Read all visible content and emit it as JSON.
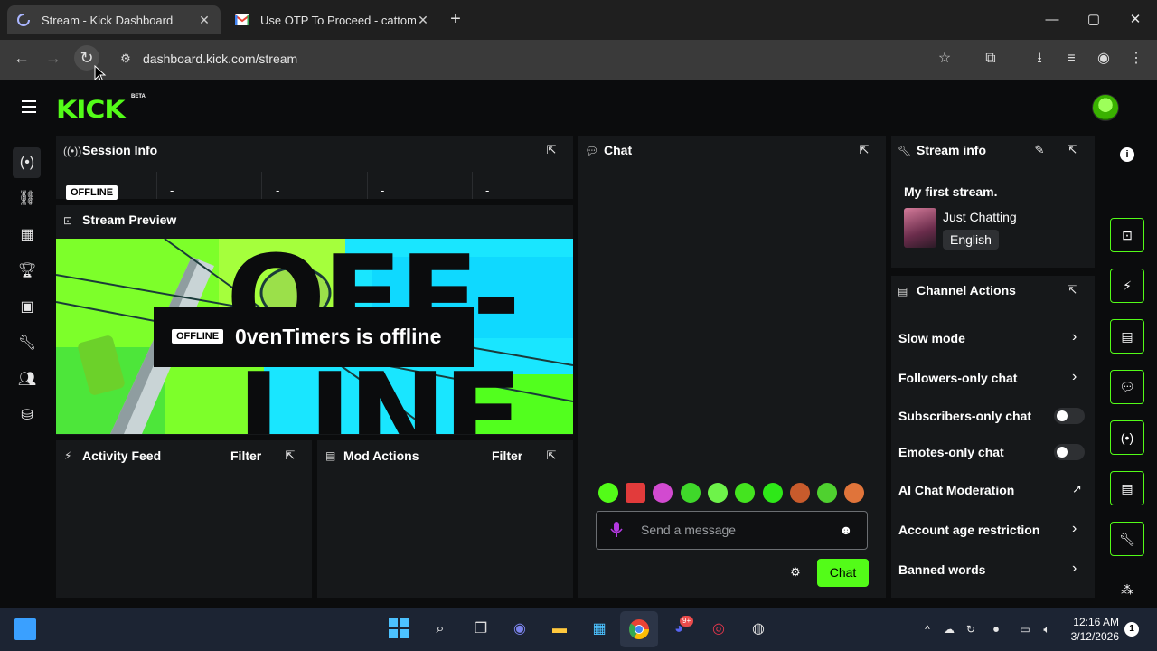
{
  "browser": {
    "tabs": [
      {
        "title": "Stream - Kick Dashboard",
        "icon": "loading-spinner-icon",
        "active": true
      },
      {
        "title": "Use OTP To Proceed - cattomti",
        "icon": "gmail-icon",
        "active": false
      }
    ],
    "new_tab_glyph": "+",
    "url": "dashboard.kick.com/stream",
    "window_controls": {
      "minimize": "—",
      "maximize": "▢",
      "close": "✕"
    }
  },
  "kick": {
    "logo": "KICK",
    "beta": "BETA",
    "accent": "#53fc18"
  },
  "session_info": {
    "title": "Session Info",
    "status": "OFFLINE",
    "stats": [
      "-",
      "-",
      "-",
      "-"
    ]
  },
  "stream_preview": {
    "title": "Stream Preview",
    "status": "OFFLINE",
    "message": "0venTimers is offline",
    "bg_text_1": "OFF-",
    "bg_text_2": "LINE"
  },
  "activity_feed": {
    "title": "Activity Feed",
    "filter": "Filter"
  },
  "mod_actions": {
    "title": "Mod Actions",
    "filter": "Filter"
  },
  "chat": {
    "title": "Chat",
    "placeholder": "Send a message",
    "send_label": "Chat",
    "emotes": [
      "emote-1",
      "emote-2",
      "emote-3",
      "emote-4",
      "emote-5",
      "emote-6",
      "emote-7",
      "emote-8",
      "emote-9",
      "emote-10"
    ]
  },
  "stream_info": {
    "title": "Stream info",
    "stream_title": "My first stream.",
    "category": "Just Chatting",
    "language": "English"
  },
  "channel_actions": {
    "title": "Channel Actions",
    "items": [
      {
        "label": "Slow mode",
        "control": "chevron"
      },
      {
        "label": "Followers-only chat",
        "control": "chevron"
      },
      {
        "label": "Subscribers-only chat",
        "control": "toggle",
        "on": false
      },
      {
        "label": "Emotes-only chat",
        "control": "toggle",
        "on": false
      },
      {
        "label": "AI Chat Moderation",
        "control": "external"
      },
      {
        "label": "Account age restriction",
        "control": "chevron"
      },
      {
        "label": "Banned words",
        "control": "chevron"
      }
    ]
  },
  "taskbar": {
    "time": "12:16 AM",
    "date": "3/12/2026",
    "notification_count": "1",
    "discord_badge": "9+"
  }
}
